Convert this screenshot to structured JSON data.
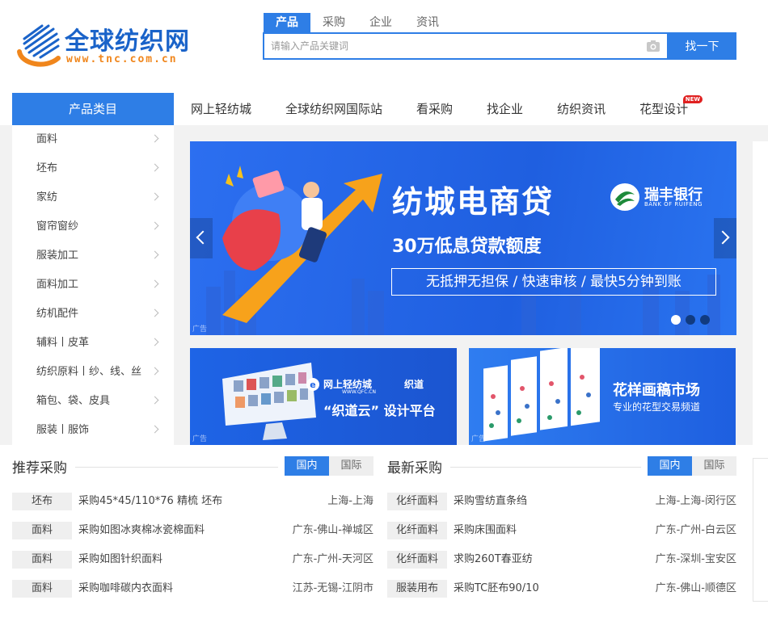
{
  "logo": {
    "title": "全球纺织网",
    "url": "www.tnc.com.cn"
  },
  "search": {
    "tabs": [
      "产品",
      "采购",
      "企业",
      "资讯"
    ],
    "active_tab": 0,
    "placeholder": "请输入产品关键词",
    "value": "",
    "button_label": "找一下"
  },
  "nav": {
    "category_title": "产品类目",
    "items": [
      "网上轻纺城",
      "全球纺织网国际站",
      "看采购",
      "找企业",
      "纺织资讯",
      "花型设计"
    ],
    "new_badge": "NEW"
  },
  "sidebar": {
    "items": [
      "面料",
      "坯布",
      "家纺",
      "窗帘窗纱",
      "服装加工",
      "面料加工",
      "纺机配件",
      "辅料丨皮革",
      "纺织原料丨纱、线、丝",
      "箱包、袋、皮具",
      "服装丨服饰"
    ]
  },
  "banner": {
    "title": "纺城电商贷",
    "subtitle": "30万低息贷款额度",
    "box_text": "无抵押无担保 / 快速审核 / 最快5分钟到账",
    "bank_name": "瑞丰银行",
    "bank_en": "BANK OF RUIFENG",
    "ad_label": "广告",
    "dots": 3,
    "active_dot": 0
  },
  "sub_banner_a": {
    "brand1": "网上轻纺城",
    "brand1_en": "WWW.QFC.CN",
    "brand2": "织道",
    "text": "“织道云” 设计平台",
    "ad_label": "广告"
  },
  "sub_banner_b": {
    "title": "花样画稿市场",
    "subtitle": "专业的花型交易频道",
    "ad_label": "广告"
  },
  "recommend": {
    "title": "推荐采购",
    "tabs": [
      "国内",
      "国际"
    ],
    "active_tab": 0,
    "rows": [
      {
        "tag": "坯布",
        "title": "采购45*45/110*76 精梳 坯布",
        "location": "上海-上海"
      },
      {
        "tag": "面料",
        "title": "采购如图冰爽棉冰瓷棉面料",
        "location": "广东-佛山-禅城区"
      },
      {
        "tag": "面料",
        "title": "采购如图针织面料",
        "location": "广东-广州-天河区"
      },
      {
        "tag": "面料",
        "title": "采购咖啡碳内衣面料",
        "location": "江苏-无锡-江阴市"
      }
    ]
  },
  "latest": {
    "title": "最新采购",
    "tabs": [
      "国内",
      "国际"
    ],
    "active_tab": 0,
    "rows": [
      {
        "tag": "化纤面料",
        "title": "采购雪纺直条绉",
        "location": "上海-上海-闵行区"
      },
      {
        "tag": "化纤面料",
        "title": "采购床围面料",
        "location": "广东-广州-白云区"
      },
      {
        "tag": "化纤面料",
        "title": "求购260T春亚纺",
        "location": "广东-深圳-宝安区"
      },
      {
        "tag": "服装用布",
        "title": "采购TC胚布90/10",
        "location": "广东-佛山-顺德区"
      }
    ]
  },
  "colors": {
    "primary": "#2e7ee6",
    "logo_blue": "#1a63c9",
    "logo_orange": "#f0861c",
    "badge_red": "#e02020"
  }
}
